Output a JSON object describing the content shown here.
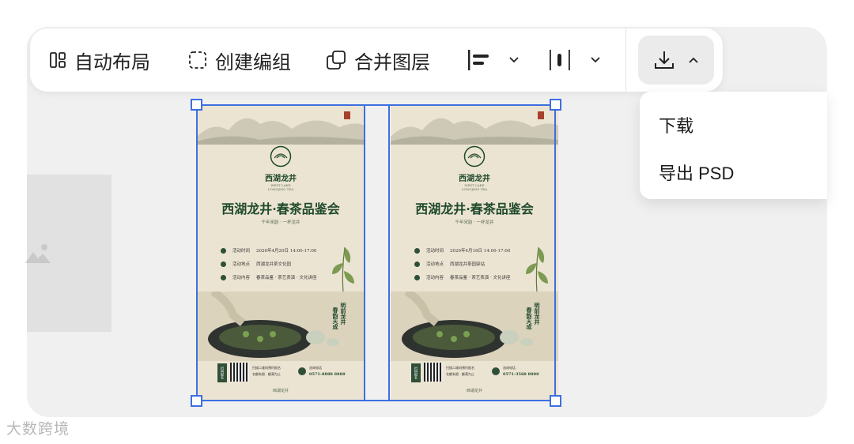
{
  "toolbar": {
    "auto_layout": "自动布局",
    "create_group": "创建编组",
    "merge_layers": "合并图层"
  },
  "download_menu": {
    "items": [
      "下载",
      "导出 PSD"
    ]
  },
  "posters": [
    {
      "brand": "西湖龙井",
      "brand_en_1": "WEST LAKE",
      "brand_en_2": "LONGJING TEA",
      "headline": "西湖龙井·春茶品鉴会",
      "tagline": "千年宋韵 · 一杯龙井",
      "rows": [
        {
          "label": "活动时间",
          "value": "2026年4月20日 14:00-17:00"
        },
        {
          "label": "活动地点",
          "value": "西湖龙井茶文化园"
        },
        {
          "label": "活动内容",
          "value": "春茶品鉴 · 茶艺表演 · 文化讲座"
        }
      ],
      "vertical_1": "明前龙井",
      "vertical_2": "春韵天成",
      "qr_text_1": "扫描二维码预约报名",
      "qr_text_2": "名额有限 · 额满为止",
      "phone_label": "咨询电话",
      "phone": "0571-8888 8888",
      "footer_brand": "西湖龙井",
      "scan_label": "扫码报名"
    },
    {
      "brand": "西湖龙井",
      "brand_en_1": "WEST LAKE",
      "brand_en_2": "LONGJING TEA",
      "headline": "西湖龙井·春茶品鉴会",
      "tagline": "千年宋韵 · 一杯龙井",
      "rows": [
        {
          "label": "活动时间",
          "value": "2026年4月18日 14:00-17:00"
        },
        {
          "label": "活动地点",
          "value": "西湖龙井茶园驿站"
        },
        {
          "label": "活动内容",
          "value": "春茶品鉴 · 茶艺表演 · 文化讲座"
        }
      ],
      "vertical_1": "明前龙井",
      "vertical_2": "春韵天成",
      "qr_text_1": "扫描二维码预约报名",
      "qr_text_2": "名额有限 · 额满为止",
      "phone_label": "咨询电话",
      "phone": "0571-3568 8888",
      "footer_brand": "西湖龙井",
      "scan_label": "扫码报名"
    }
  ],
  "watermark": "大数跨境",
  "colors": {
    "selection": "#3d6fe0",
    "poster_bg": "#ece4d2",
    "poster_green": "#1f4a2c"
  }
}
